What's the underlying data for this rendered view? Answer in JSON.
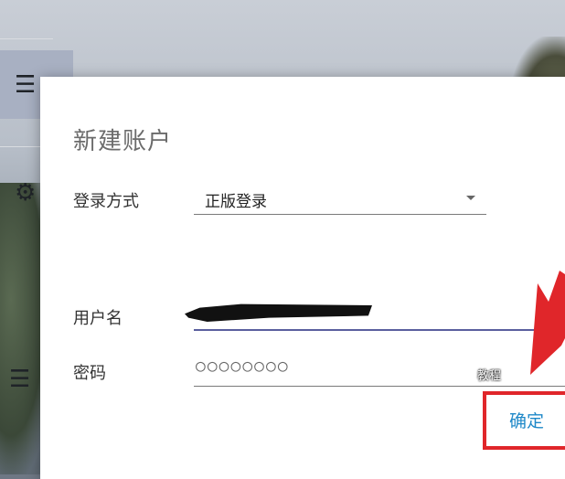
{
  "dialog": {
    "title": "新建账户",
    "login_method_label": "登录方式",
    "login_method_value": "正版登录",
    "username_label": "用户名",
    "username_value": "",
    "password_label": "密码",
    "password_value": "○○○○○○○○",
    "confirm_label": "确定"
  },
  "sidebar": {
    "icons": [
      "list-icon",
      "gear-icon",
      "list-icon"
    ]
  },
  "watermark": "教程",
  "colors": {
    "accent": "#1e88c8",
    "annotation_red": "#e0262a",
    "input_focus": "#5a5f9e"
  }
}
